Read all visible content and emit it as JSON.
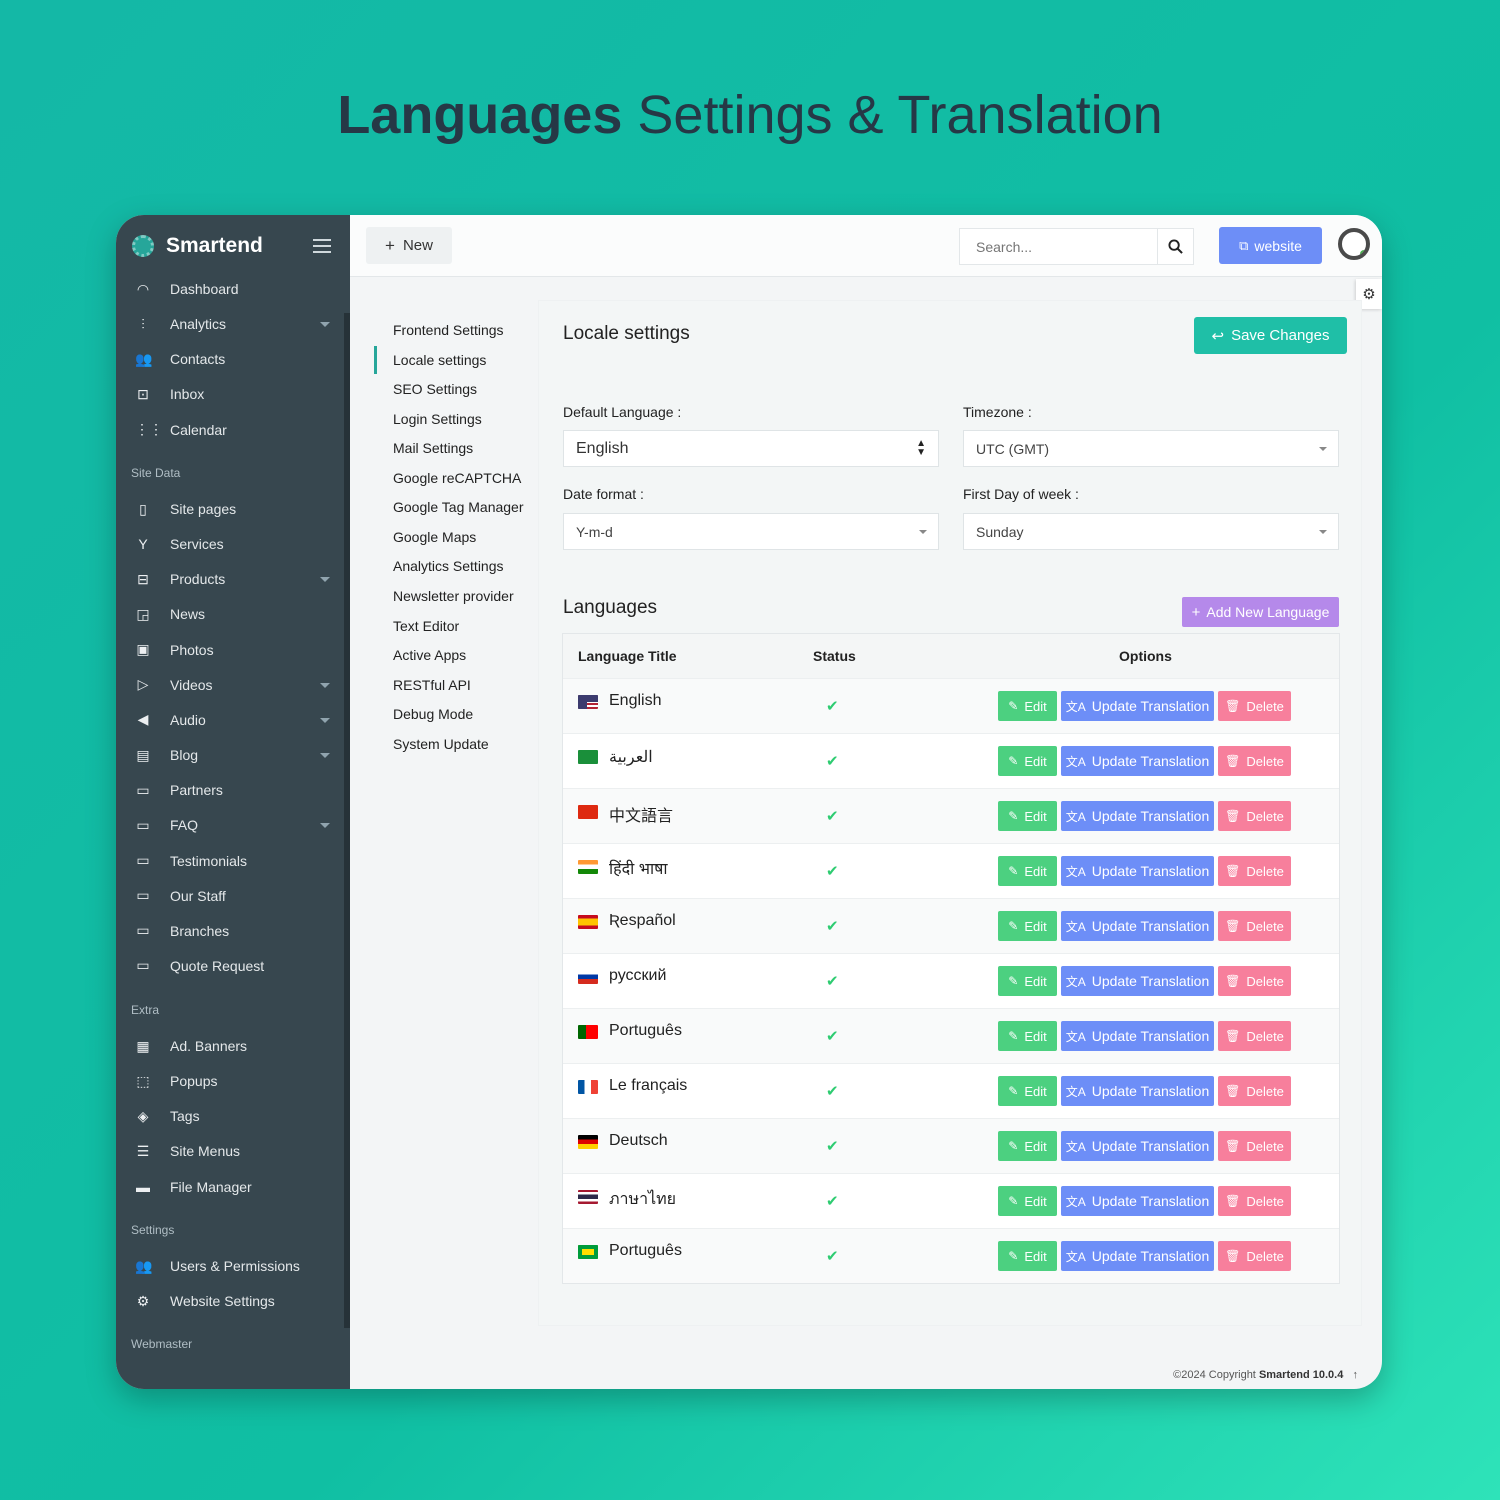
{
  "headline": {
    "bold": "Languages",
    "rest": "Settings & Translation"
  },
  "brand": {
    "name": "Smartend"
  },
  "sidebar": {
    "items": [
      {
        "label": "Dashboard",
        "icon": "dashboard-icon",
        "glyph": "◠",
        "top": 0,
        "caret": false
      },
      {
        "label": "Analytics",
        "icon": "analytics-icon",
        "glyph": "⫶",
        "caret": true
      },
      {
        "label": "Contacts",
        "icon": "contacts-icon",
        "glyph": "👥",
        "caret": false
      },
      {
        "label": "Inbox",
        "icon": "inbox-icon",
        "glyph": "⊡",
        "caret": false
      },
      {
        "label": "Calendar",
        "icon": "calendar-icon",
        "glyph": "⋮⋮",
        "caret": false
      }
    ],
    "site_data_label": "Site Data",
    "site_items": [
      {
        "label": "Site pages",
        "icon": "site-pages-icon",
        "glyph": "▯",
        "caret": false
      },
      {
        "label": "Services",
        "icon": "services-icon",
        "glyph": "Y",
        "caret": false
      },
      {
        "label": "Products",
        "icon": "products-icon",
        "glyph": "⊟",
        "caret": true
      },
      {
        "label": "News",
        "icon": "news-icon",
        "glyph": "◲",
        "caret": false
      },
      {
        "label": "Photos",
        "icon": "photos-icon",
        "glyph": "▣",
        "caret": false
      },
      {
        "label": "Videos",
        "icon": "videos-icon",
        "glyph": "▷",
        "caret": true
      },
      {
        "label": "Audio",
        "icon": "audio-icon",
        "glyph": "◀",
        "caret": true
      },
      {
        "label": "Blog",
        "icon": "blog-icon",
        "glyph": "▤",
        "caret": true
      },
      {
        "label": "Partners",
        "icon": "folder-icon",
        "glyph": "▭",
        "caret": false
      },
      {
        "label": "FAQ",
        "icon": "folder-icon",
        "glyph": "▭",
        "caret": true
      },
      {
        "label": "Testimonials",
        "icon": "folder-icon",
        "glyph": "▭",
        "caret": false
      },
      {
        "label": "Our Staff",
        "icon": "folder-icon",
        "glyph": "▭",
        "caret": false
      },
      {
        "label": "Branches",
        "icon": "folder-icon",
        "glyph": "▭",
        "caret": false
      },
      {
        "label": "Quote Request",
        "icon": "folder-icon",
        "glyph": "▭",
        "caret": false
      }
    ],
    "extra_label": "Extra",
    "extra_items": [
      {
        "label": "Ad. Banners",
        "icon": "banners-icon",
        "glyph": "▦",
        "caret": false
      },
      {
        "label": "Popups",
        "icon": "popups-icon",
        "glyph": "⬚",
        "caret": false
      },
      {
        "label": "Tags",
        "icon": "tags-icon",
        "glyph": "◈",
        "caret": false
      },
      {
        "label": "Site Menus",
        "icon": "menu-list-icon",
        "glyph": "☰",
        "caret": false
      },
      {
        "label": "File Manager",
        "icon": "file-manager-icon",
        "glyph": "▬",
        "caret": false
      }
    ],
    "settings_label": "Settings",
    "settings_items": [
      {
        "label": "Users & Permissions",
        "icon": "users-icon",
        "glyph": "👥",
        "caret": false
      },
      {
        "label": "Website Settings",
        "icon": "gear-icon",
        "glyph": "⚙",
        "caret": false
      }
    ],
    "webmaster_label": "Webmaster"
  },
  "topbar": {
    "new_label": "New",
    "search_placeholder": "Search...",
    "website_label": "website"
  },
  "settings_menu": [
    "Frontend Settings",
    "Locale settings",
    "SEO Settings",
    "Login Settings",
    "Mail Settings",
    "Google reCAPTCHA",
    "Google Tag Manager",
    "Google Maps",
    "Analytics Settings",
    "Newsletter provider",
    "Text Editor",
    "Active Apps",
    "RESTful API",
    "Debug Mode",
    "System Update"
  ],
  "settings_menu_active": 1,
  "locale": {
    "title": "Locale settings",
    "save_label": "Save Changes",
    "default_language_label": "Default Language :",
    "default_language_value": "English",
    "timezone_label": "Timezone :",
    "timezone_value": "UTC (GMT)",
    "date_format_label": "Date format :",
    "date_format_value": "Y-m-d",
    "first_day_label": "First Day of week :",
    "first_day_value": "Sunday"
  },
  "languages": {
    "title": "Languages",
    "add_label": "Add New Language",
    "columns": {
      "title": "Language Title",
      "status": "Status",
      "options": "Options"
    },
    "buttons": {
      "edit": "Edit",
      "update": "Update Translation",
      "delete": "Delete"
    },
    "rows": [
      {
        "name": "English",
        "flag": "us",
        "active": true
      },
      {
        "name": "العربية",
        "flag": "sa",
        "active": true
      },
      {
        "name": "中文語言",
        "flag": "cn",
        "active": true
      },
      {
        "name": "हिंदी भाषा",
        "flag": "in",
        "active": true
      },
      {
        "name": "Ʀespañol",
        "flag": "es",
        "active": true
      },
      {
        "name": "русский",
        "flag": "ru",
        "active": true
      },
      {
        "name": "Português",
        "flag": "pt",
        "active": true
      },
      {
        "name": "Le français",
        "flag": "fr",
        "active": true
      },
      {
        "name": "Deutsch",
        "flag": "de",
        "active": true
      },
      {
        "name": "ภาษาไทย",
        "flag": "th",
        "active": true
      },
      {
        "name": "Português",
        "flag": "br",
        "active": true
      }
    ]
  },
  "footer": {
    "copyright": "©2024 Copyright",
    "product": "Smartend 10.0.4"
  },
  "colors": {
    "sidebar": "#37474f",
    "accent": "#1fbfa7",
    "primary": "#6d8ef7",
    "success": "#4cd080",
    "danger": "#f77f9c",
    "purple": "#b589ea"
  }
}
